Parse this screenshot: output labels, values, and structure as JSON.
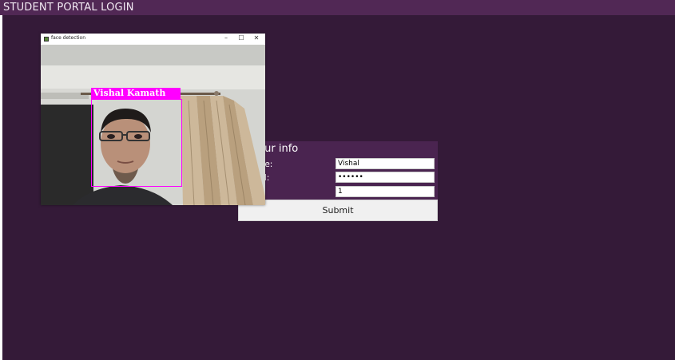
{
  "app": {
    "title": "STUDENT PORTAL LOGIN"
  },
  "form": {
    "title": "r your info",
    "fields": [
      {
        "label": "name:",
        "value": "Vishal"
      },
      {
        "label": "word:",
        "value": "••••••"
      },
      {
        "label": "",
        "value": "1"
      }
    ],
    "submit_label": "Submit"
  },
  "camera_window": {
    "title": "face detection",
    "minimize": "–",
    "maximize": "☐",
    "close": "✕",
    "detected_name": "Vishal Kamath"
  },
  "colors": {
    "background": "#341a38",
    "title_bar": "#512855",
    "form_header": "#4a2450",
    "detection_box": "#ff00ff"
  }
}
